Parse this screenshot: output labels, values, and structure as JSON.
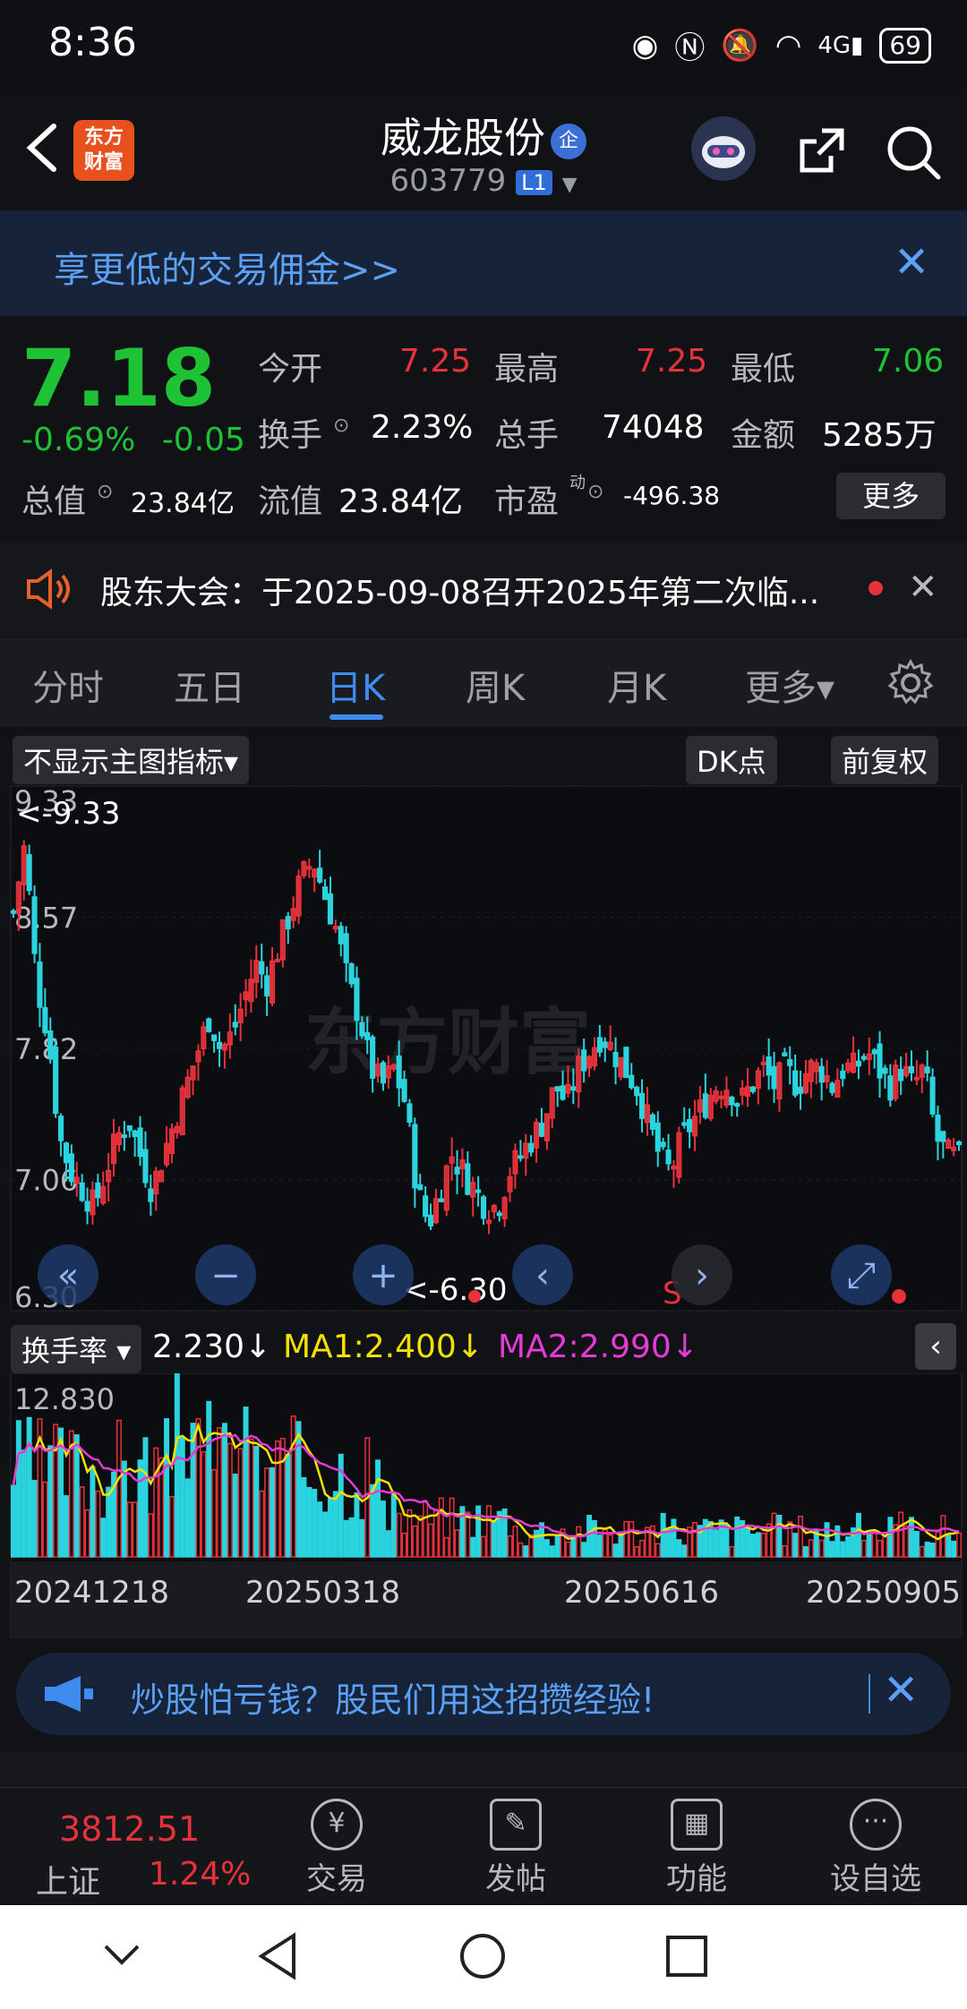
{
  "status_bar": {
    "time": "8:36",
    "battery": "69"
  },
  "header": {
    "logo_line1": "东方",
    "logo_line2": "财富",
    "stock_name": "威龙股份",
    "badge": "企",
    "stock_code": "603779",
    "level": "L1"
  },
  "promo": {
    "text": "享更低的交易佣金>>",
    "close": "✕"
  },
  "quote": {
    "price": "7.18",
    "change_pct": "-0.69%",
    "change": "-0.05",
    "open_label": "今开",
    "open": "7.25",
    "high_label": "最高",
    "high": "7.25",
    "low_label": "最低",
    "low": "7.06",
    "turnover_label": "换手",
    "turnover": "2.23%",
    "volume_label": "总手",
    "volume": "74048",
    "amount_label": "金额",
    "amount": "5285万",
    "mktcap_label": "总值",
    "mktcap": "23.84亿",
    "float_label": "流值",
    "float_cap": "23.84亿",
    "pe_label": "市盈",
    "pe_sup": "动",
    "pe": "-496.38",
    "more": "更多"
  },
  "notice": {
    "text": "股东大会：于2025-09-08召开2025年第二次临...",
    "close": "✕"
  },
  "tabs": [
    {
      "label": "分时"
    },
    {
      "label": "五日"
    },
    {
      "label": "日K"
    },
    {
      "label": "周K"
    },
    {
      "label": "月K"
    },
    {
      "label": "更多▾"
    }
  ],
  "chart_toolbar": {
    "indicator": "不显示主图指标▾",
    "dk": "DK点",
    "fq": "前复权"
  },
  "chart_data": {
    "type": "candlestick",
    "y_ticks": [
      "9.33",
      "8.57",
      "7.82",
      "7.06",
      "6.30"
    ],
    "max_label": "<-9.33",
    "min_label": "<-6.30",
    "watermark": "东方财富",
    "sell_marker": "S",
    "ylim": [
      6.3,
      9.33
    ],
    "close_path": [
      8.6,
      9.0,
      8.2,
      7.9,
      7.3,
      7.1,
      7.0,
      6.9,
      7.1,
      7.3,
      7.4,
      7.2,
      7.0,
      7.2,
      7.4,
      7.6,
      7.8,
      8.0,
      7.8,
      7.9,
      8.1,
      8.3,
      8.2,
      8.4,
      8.6,
      8.8,
      8.9,
      8.7,
      8.5,
      8.2,
      8.0,
      7.7,
      7.6,
      7.7,
      7.5,
      7.0,
      6.8,
      7.0,
      7.2,
      7.1,
      7.0,
      6.9,
      6.9,
      7.1,
      7.2,
      7.3,
      7.4,
      7.6,
      7.5,
      7.7,
      7.8,
      7.9,
      7.8,
      7.7,
      7.6,
      7.4,
      7.2,
      7.1,
      7.3,
      7.4,
      7.5,
      7.6,
      7.6,
      7.5,
      7.6,
      7.7,
      7.6,
      7.7,
      7.6,
      7.7,
      7.7,
      7.6,
      7.7,
      7.7,
      7.8,
      7.7,
      7.6,
      7.7,
      7.6,
      7.7,
      7.3,
      7.2,
      7.18
    ]
  },
  "volume_indicator": {
    "name": "换手率",
    "value": "2.230↓",
    "ma1": "MA1:2.400↓",
    "ma2": "MA2:2.990↓",
    "max_label": "12.830",
    "dates": [
      "20241218",
      "20250318",
      "20250616",
      "20250905"
    ]
  },
  "ad": {
    "text": "炒股怕亏钱？股民们用这招攒经验!",
    "close": "✕"
  },
  "bottom_nav": {
    "index_value": "3812.51",
    "index_name": "上证",
    "index_pct": "1.24%",
    "items": [
      {
        "label": "交易"
      },
      {
        "label": "发帖"
      },
      {
        "label": "功能"
      },
      {
        "label": "设自选"
      }
    ]
  },
  "colors": {
    "up": "#e7323c",
    "down": "#1ec235",
    "accent": "#3e8cf0",
    "cyan_candle": "#2ad4df"
  }
}
